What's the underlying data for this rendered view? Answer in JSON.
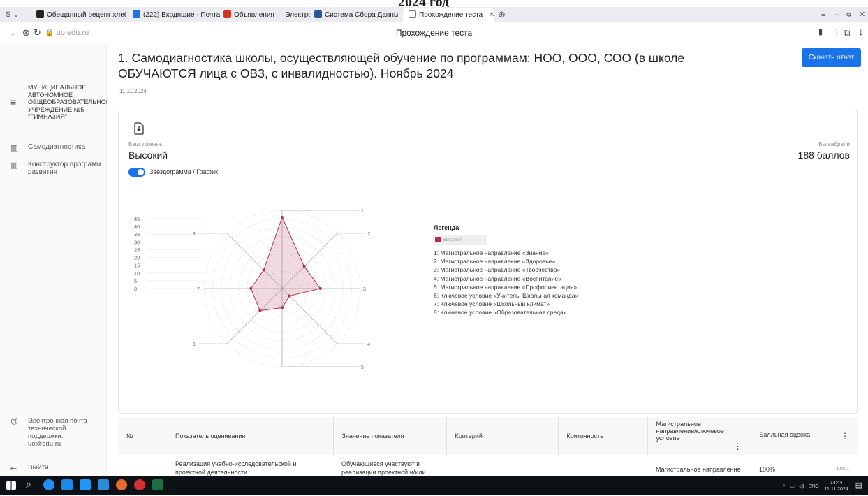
{
  "caption": "2024 год",
  "browser": {
    "tabs": [
      {
        "label": "Обещанный рецепт хлеб",
        "color": "#222"
      },
      {
        "label": "(222) Входящие - Почта",
        "color": "#1a73e8"
      },
      {
        "label": "Объявления — Электрон",
        "color": "#d93025"
      },
      {
        "label": "Система Сбора Данных",
        "color": "#2b579a"
      },
      {
        "label": "Прохождение теста",
        "color": "#888"
      }
    ],
    "url": "uo.edu.ru",
    "page_title": "Прохождение теста"
  },
  "sidebar": {
    "org": "МУНИЦИПАЛЬНОЕ АВТОНОМНОЕ ОБЩЕОБРАЗОВАТЕЛЬНОЕ УЧРЕЖДЕНИЕ №5 \"ГИМНАЗИЯ\"",
    "items": [
      {
        "label": "Самодиагностика"
      },
      {
        "label": "Конструктор программ развития"
      }
    ],
    "support": "Электронная почта технической поддержки: uo@edu.ru",
    "logout": "Выйти"
  },
  "main": {
    "title": "1. Самодиагностика школы, осуществляющей обучение по программам: НОО, ООО, СОО (в школе ОБУЧАЮТСЯ лица с ОВЗ, с инвалидностью). Ноябрь 2024",
    "date": "11.11.2024",
    "download_label": "Скачать отчет",
    "level_label": "Ваш уровень",
    "level_value": "Высокий",
    "score_label": "Вы набрали",
    "score_value": "188 баллов",
    "toggle_label": "Звездограмма / График",
    "legend_title": "Легенда",
    "legend_chip": "Высокий",
    "legend_items": [
      "1: Магистральное направление «Знание»",
      "2: Магистральное направление «Здоровье»",
      "3: Магистральное направление «Творчество»",
      "4: Магистральное направление «Воспитание»",
      "5: Магистральное направление «Профориентация»",
      "6: Ключевое условие «Учитель. Школьная команда»",
      "7: Ключевое условие «Школьный климат»",
      "8: Ключевое условие «Образовательная среда»"
    ]
  },
  "chart_data": {
    "type": "radar",
    "axes": [
      "1",
      "2",
      "3",
      "4",
      "5",
      "6",
      "7",
      "8"
    ],
    "ticks": [
      "0",
      "5",
      "10",
      "15",
      "20",
      "25",
      "30",
      "35",
      "40",
      "45"
    ],
    "rmax": 45,
    "series": [
      {
        "name": "Высокий",
        "values": [
          41,
          18,
          22,
          6,
          11,
          18,
          18,
          15
        ],
        "color": "#b03050"
      }
    ],
    "grid": true
  },
  "table": {
    "headers": [
      "№",
      "Показатель оценивания",
      "Значение показателя",
      "Критерий",
      "Критичность",
      "Магистральное направление/ключевое условие",
      "Балльная оценка"
    ],
    "row": [
      "",
      "Реализация учебно-исследовательской и проектной деятельности",
      "Обучающиеся участвуют в реализации проектной и/или",
      "",
      "",
      "Магистральное направление",
      "100%"
    ],
    "paging": "1 из 1"
  },
  "taskbar": {
    "lang": "ENG",
    "time": "14:44",
    "date": "11.11.2024"
  }
}
